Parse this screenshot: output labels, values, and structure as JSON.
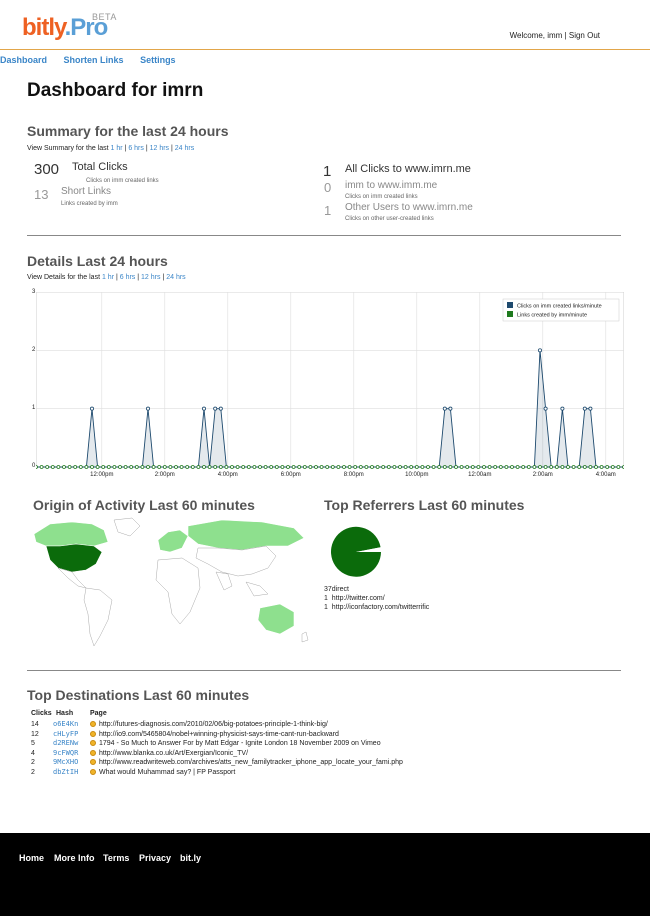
{
  "header": {
    "logo_part1": "bitly",
    "logo_part2": ".Pro",
    "beta": "BETA",
    "welcome": "Welcome, imm | Sign Out"
  },
  "nav": {
    "dashboard": "Dashboard",
    "shorten": "Shorten Links",
    "settings": "Settings"
  },
  "page_title": "Dashboard for imrn",
  "summary": {
    "title": "Summary for the last 24 hours",
    "view_prefix": "View Summary for the last",
    "ranges": [
      "1 hr",
      "6 hrs",
      "12 hrs",
      "24 hrs"
    ],
    "total_clicks_value": "300",
    "total_clicks_label": "Total Clicks",
    "total_clicks_sub": "Clicks on imm created links",
    "short_links_value": "13",
    "short_links_label": "Short Links",
    "short_links_sub": "Links created by imm",
    "all_clicks_value": "1",
    "all_clicks_label": "All Clicks to www.imrn.me",
    "imm_value": "0",
    "imm_label": "imm to www.imm.me",
    "imm_sub": "Clicks on imm created links",
    "other_value": "1",
    "other_label": "Other Users to www.imrn.me",
    "other_sub": "Clicks on other user-created links"
  },
  "details": {
    "title": "Details Last 24 hours",
    "view_prefix": "View Details for the last",
    "ranges": [
      "1 hr",
      "6 hrs",
      "12 hrs",
      "24 hrs"
    ]
  },
  "chart_data": {
    "type": "line",
    "ylim": [
      0,
      3
    ],
    "yticks": [
      "0",
      "1",
      "2",
      "3"
    ],
    "xticks": [
      "12:00pm",
      "2:00pm",
      "4:00pm",
      "6:00pm",
      "8:00pm",
      "10:00pm",
      "12:00am",
      "2:00am",
      "4:00am"
    ],
    "legend_position": "top-right",
    "series": [
      {
        "name": "Clicks on imm created links/minute",
        "color": "#1e4a6e",
        "peaks": [
          [
            1.9,
            1
          ],
          [
            2.0,
            1
          ],
          [
            4.0,
            1
          ],
          [
            6.1,
            1
          ],
          [
            6.5,
            1
          ],
          [
            6.7,
            1
          ],
          [
            14.6,
            1
          ],
          [
            14.8,
            1
          ],
          [
            18.0,
            2
          ],
          [
            18.2,
            1
          ],
          [
            18.7,
            1
          ],
          [
            19.6,
            1
          ],
          [
            19.8,
            1
          ]
        ]
      },
      {
        "name": "Links created by imm/minute",
        "color": "#1e7a1e",
        "value": 0
      }
    ],
    "grid": true
  },
  "origin": {
    "title": "Origin of Activity Last 60 minutes"
  },
  "referrers": {
    "title": "Top Referrers Last 60 minutes",
    "items": [
      {
        "count": "37",
        "label": "direct"
      },
      {
        "count": "1",
        "label": "http://twitter.com/"
      },
      {
        "count": "1",
        "label": "http://iconfactory.com/twitterrific"
      }
    ],
    "pie_color": "#0b6b0b"
  },
  "destinations": {
    "title": "Top Destinations Last 60 minutes",
    "col_clicks": "Clicks",
    "col_hash": "Hash",
    "col_page": "Page",
    "rows": [
      {
        "clicks": "14",
        "hash": "o6E4Kn",
        "page": "http://futures-diagnosis.com/2010/02/06/big-potatoes-principle-1-think-big/"
      },
      {
        "clicks": "12",
        "hash": "cHLyFP",
        "page": "http://io9.com/5465804/nobel+winning-physicist-says-time-cant-run-backward"
      },
      {
        "clicks": "5",
        "hash": "d2RENw",
        "page": "1794 - So Much to Answer For by Matt Edgar - Ignite London 18 November 2009 on Vimeo"
      },
      {
        "clicks": "4",
        "hash": "9cFWQR",
        "page": "http://www.blanka.co.uk/Art/Exergian/Iconic_TV/"
      },
      {
        "clicks": "2",
        "hash": "9McXHO",
        "page": "http://www.readwriteweb.com/archives/atts_new_familytracker_iphone_app_locate_your_fami.php"
      },
      {
        "clicks": "2",
        "hash": "dbZtIH",
        "page": "What would Muhammad say? | FP Passport"
      }
    ]
  },
  "footer": {
    "home": "Home",
    "more": "More Info",
    "terms": "Terms",
    "privacy": "Privacy",
    "bitly": "bit.ly"
  }
}
